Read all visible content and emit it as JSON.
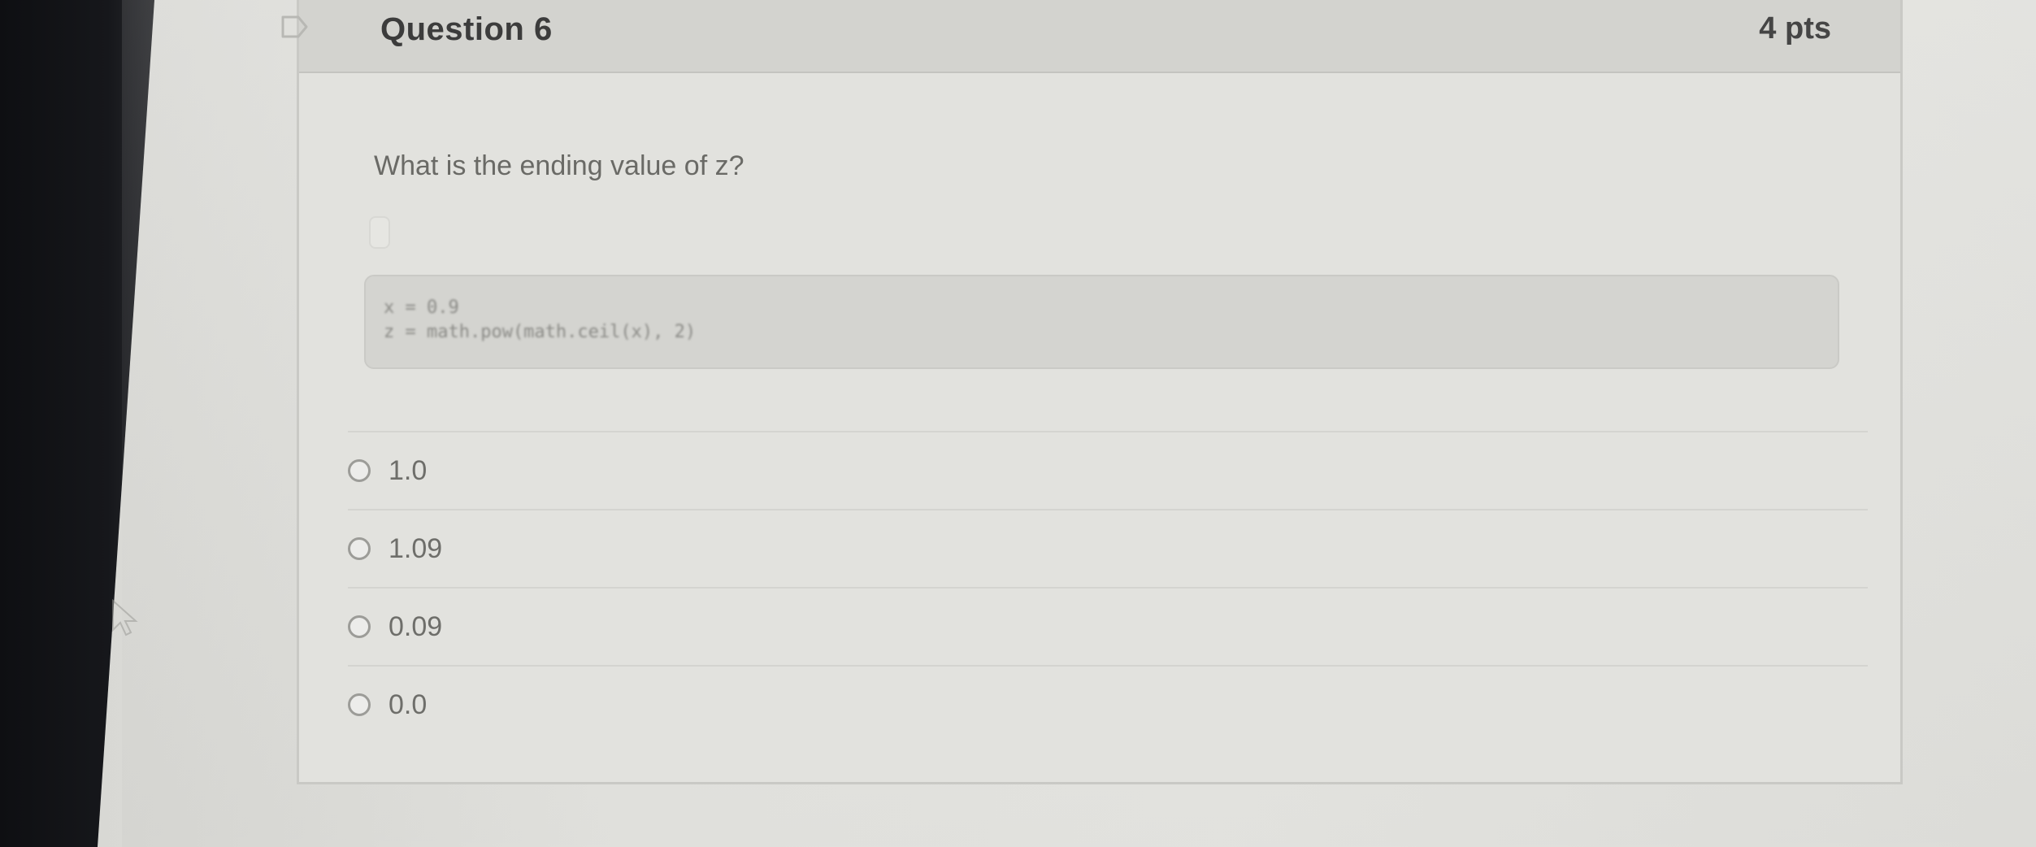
{
  "question": {
    "title": "Question 6",
    "points": "4 pts",
    "prompt": "What is the ending value of z?",
    "code_lines": [
      "x = 0.9",
      "z = math.pow(math.ceil(x), 2)"
    ]
  },
  "answers": [
    {
      "label": "1.0"
    },
    {
      "label": "1.09"
    },
    {
      "label": "0.09"
    },
    {
      "label": "0.0"
    }
  ],
  "colors": {
    "header_bg": "#d3d3cf",
    "card_bg": "#e2e2de",
    "code_bg": "#d4d4d0"
  },
  "icons": {
    "flag": "bookmark-flag-icon",
    "radio": "radio-circle-icon"
  }
}
